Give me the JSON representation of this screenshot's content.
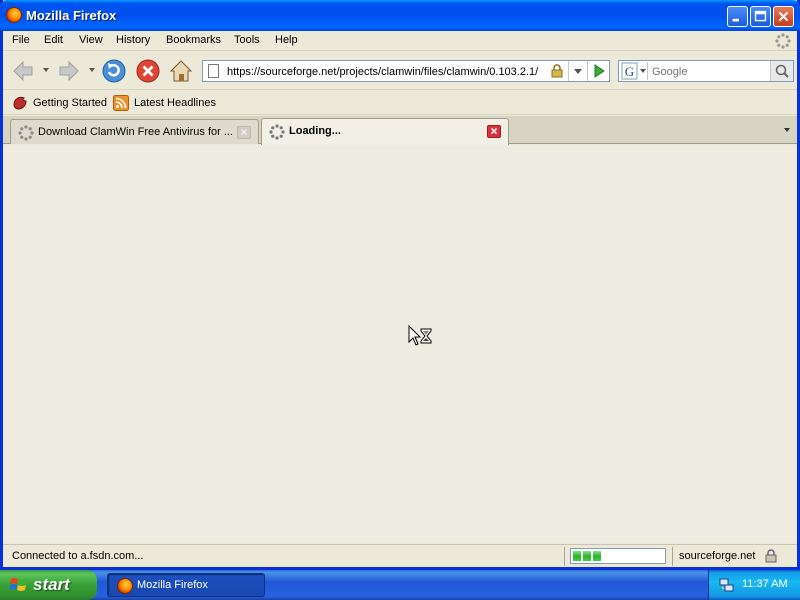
{
  "window": {
    "title": "Mozilla Firefox"
  },
  "menu": {
    "items": [
      "File",
      "Edit",
      "View",
      "History",
      "Bookmarks",
      "Tools",
      "Help"
    ]
  },
  "navbar": {
    "url": "https://sourceforge.net/projects/clamwin/files/clamwin/0.103.2.1/",
    "search_placeholder": "Google",
    "search_engine": "G"
  },
  "bookmarks": {
    "items": [
      {
        "label": "Getting Started",
        "icon": "firefox-bookmark-icon"
      },
      {
        "label": "Latest Headlines",
        "icon": "rss-feed-icon"
      }
    ]
  },
  "tabs": [
    {
      "label": "Download ClamWin Free Antivirus for ...",
      "active": false
    },
    {
      "label": "Loading...",
      "active": true
    }
  ],
  "status": {
    "text": "Connected to a.fsdn.com...",
    "progress_segments": 3,
    "domain": "sourceforge.net"
  },
  "taskbar": {
    "start_label": "start",
    "task_label": "Mozilla Firefox",
    "clock": "11:37 AM"
  },
  "colors": {
    "titlebar": "#0053ee",
    "start_green": "#38a038",
    "progress_green": "#2bb52b",
    "tab_close_active": "#d9333c"
  }
}
